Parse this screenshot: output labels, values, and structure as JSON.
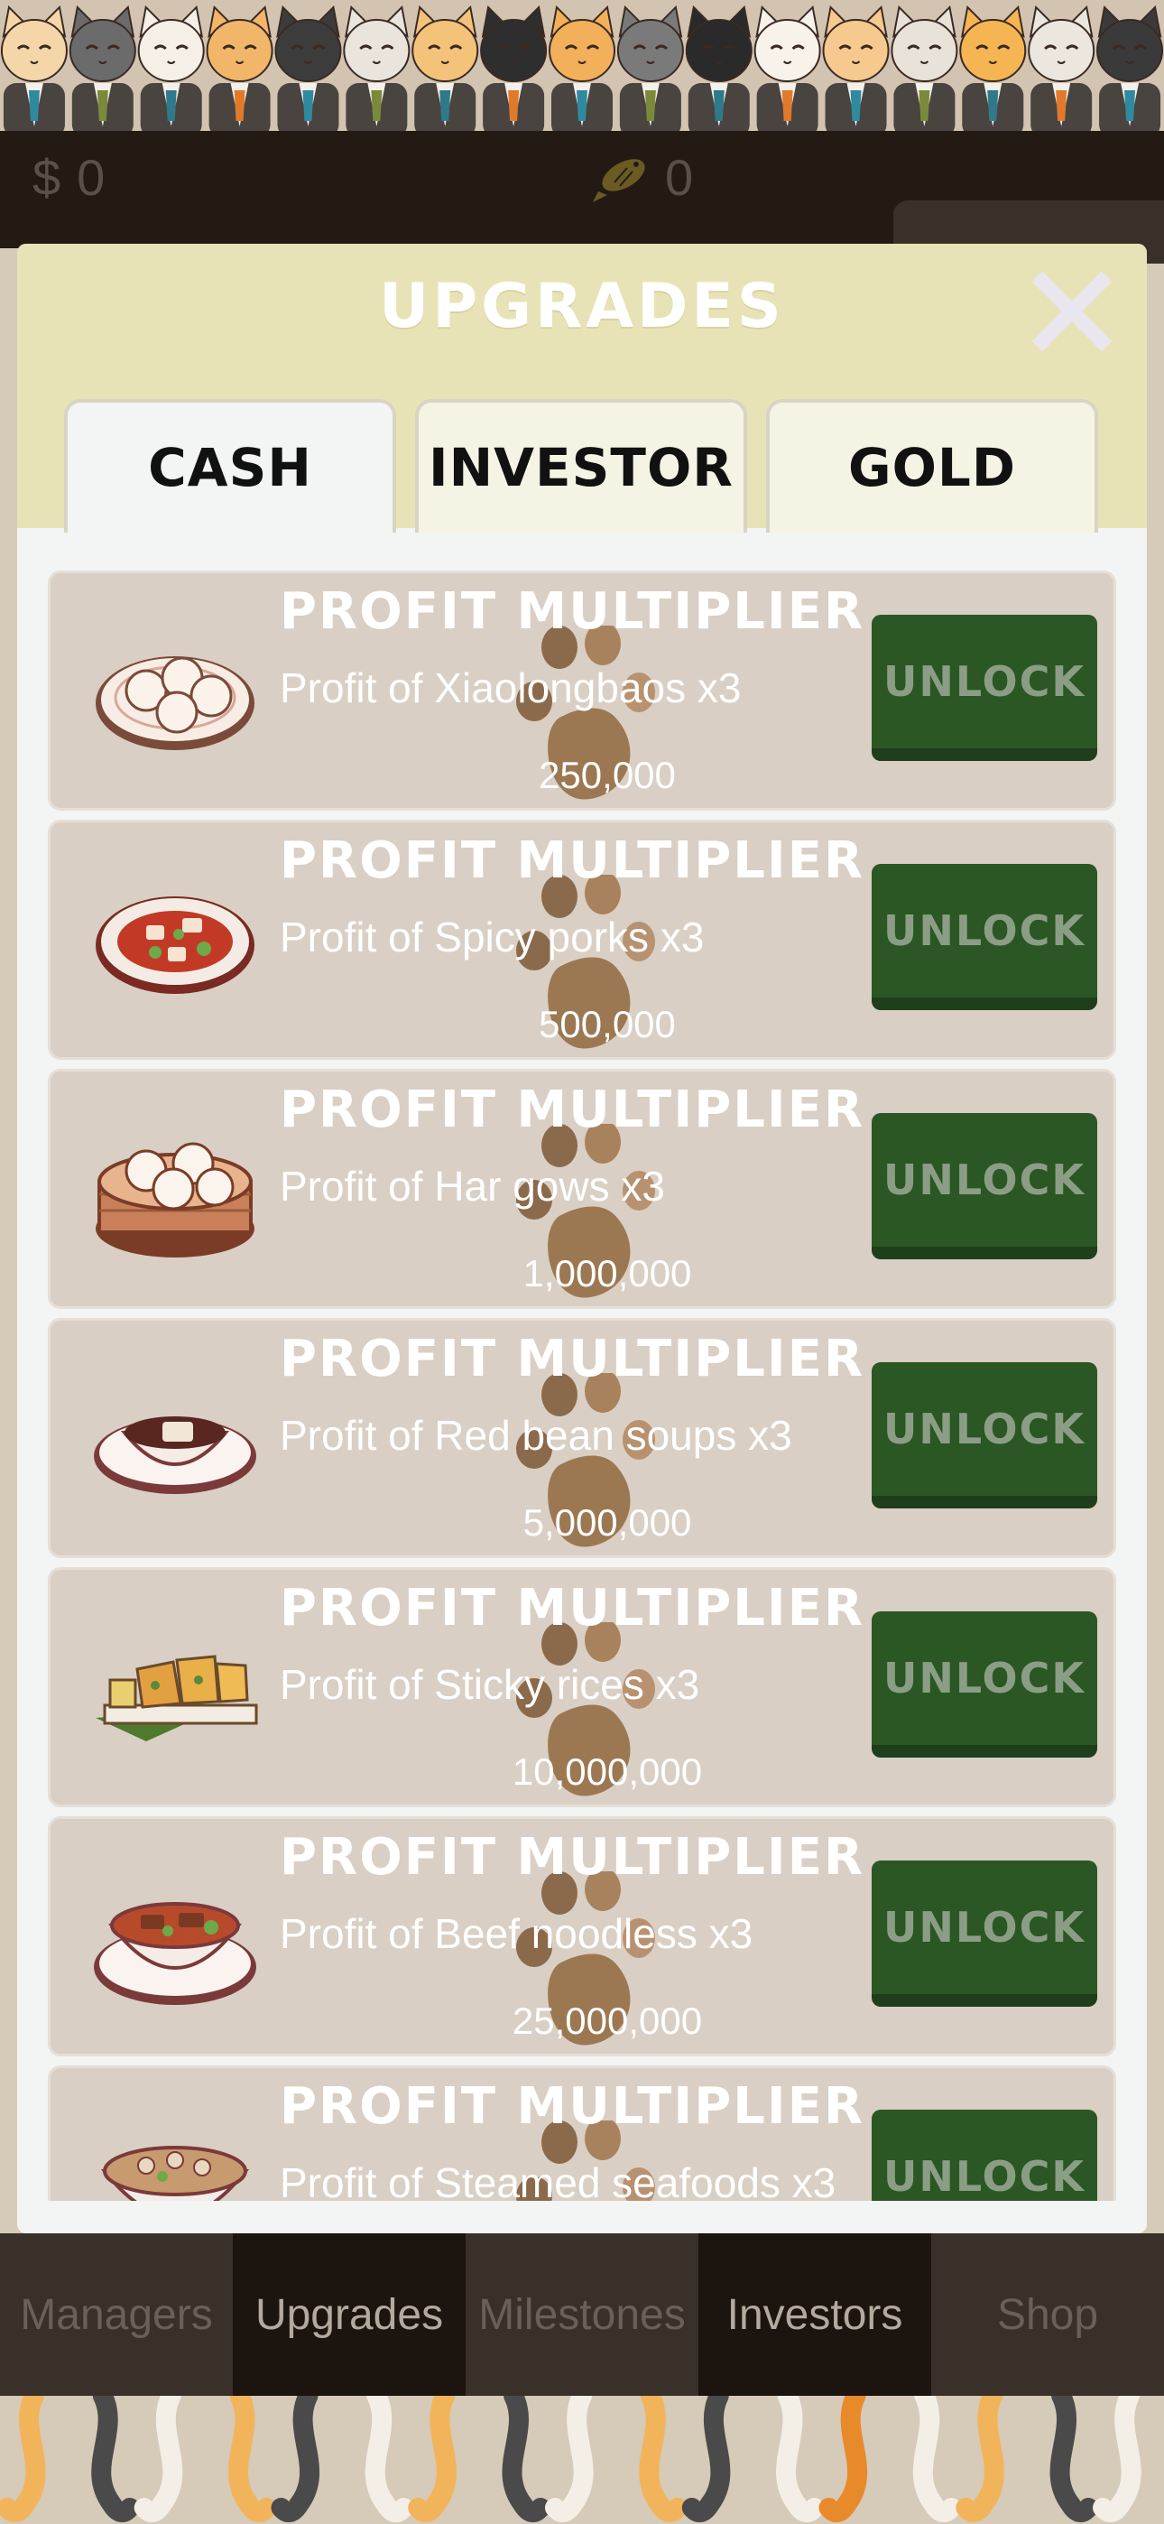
{
  "header": {
    "cash_symbol": "$",
    "cash_value": "0",
    "fish_value": "0"
  },
  "modal": {
    "title": "UPGRADES",
    "tabs": [
      {
        "label": "CASH",
        "active": true
      },
      {
        "label": "INVESTOR",
        "active": false
      },
      {
        "label": "GOLD",
        "active": false
      }
    ]
  },
  "upgrades": [
    {
      "title": "PROFIT MULTIPLIER",
      "description": "Profit of Xiaolongbaos x3",
      "cost": "250,000",
      "button": "UNLOCK",
      "icon": "xiaolongbao-plate-icon"
    },
    {
      "title": "PROFIT MULTIPLIER",
      "description": "Profit of Spicy porks x3",
      "cost": "500,000",
      "button": "UNLOCK",
      "icon": "spicy-pork-plate-icon"
    },
    {
      "title": "PROFIT MULTIPLIER",
      "description": "Profit of Har gows x3",
      "cost": "1,000,000",
      "button": "UNLOCK",
      "icon": "har-gow-steamer-icon"
    },
    {
      "title": "PROFIT MULTIPLIER",
      "description": "Profit of Red bean soups x3",
      "cost": "5,000,000",
      "button": "UNLOCK",
      "icon": "red-bean-soup-icon"
    },
    {
      "title": "PROFIT MULTIPLIER",
      "description": "Profit of Sticky rices x3",
      "cost": "10,000,000",
      "button": "UNLOCK",
      "icon": "sticky-rice-icon"
    },
    {
      "title": "PROFIT MULTIPLIER",
      "description": "Profit of Beef noodless x3",
      "cost": "25,000,000",
      "button": "UNLOCK",
      "icon": "beef-noodle-bowl-icon"
    },
    {
      "title": "PROFIT MULTIPLIER",
      "description": "Profit of Steamed seafoods x3",
      "cost": "",
      "button": "UNLOCK",
      "icon": "seafood-bowl-icon"
    }
  ],
  "nav": [
    {
      "label": "Managers"
    },
    {
      "label": "Upgrades",
      "active": true
    },
    {
      "label": "Milestones"
    },
    {
      "label": "Investors"
    },
    {
      "label": "Shop"
    }
  ],
  "colors": {
    "unlock_button": "#2a5724",
    "card": "#d9cfc4",
    "modal_header": "#e8e3b6",
    "header_bar": "#231a14"
  }
}
